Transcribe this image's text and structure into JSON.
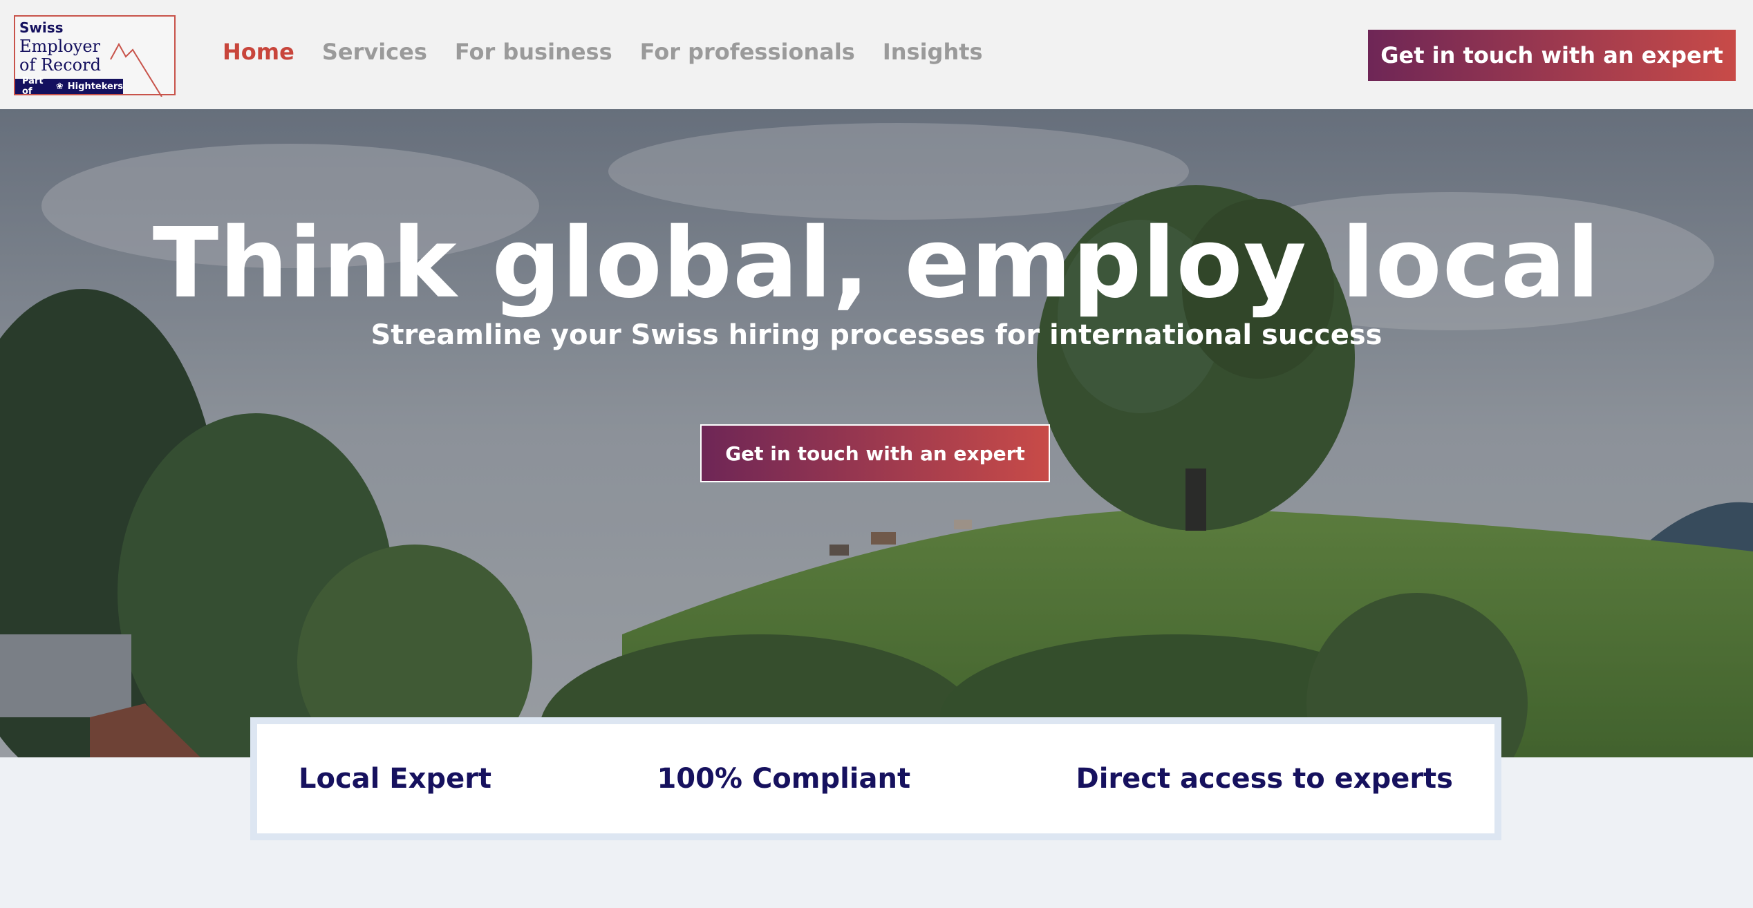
{
  "brand": {
    "line1": "Swiss",
    "line2": "Employer",
    "line3": "of Record",
    "badge": "Part of",
    "badge_brand": "Hightekers"
  },
  "nav": {
    "items": [
      {
        "label": "Home",
        "active": true
      },
      {
        "label": "Services",
        "active": false
      },
      {
        "label": "For business",
        "active": false
      },
      {
        "label": "For professionals",
        "active": false
      },
      {
        "label": "Insights",
        "active": false
      }
    ],
    "cta": "Get in touch with an expert"
  },
  "hero": {
    "title": "Think global, employ local",
    "subtitle": "Streamline your Swiss hiring processes for international success",
    "cta": "Get in touch with an expert"
  },
  "features": [
    {
      "label": "Local Expert"
    },
    {
      "label": "100% Compliant"
    },
    {
      "label": "Direct access to experts"
    }
  ],
  "colors": {
    "accent_start": "#6e2656",
    "accent_end": "#c84b48",
    "nav_active": "#c8453b",
    "brand_navy": "#14105e"
  }
}
